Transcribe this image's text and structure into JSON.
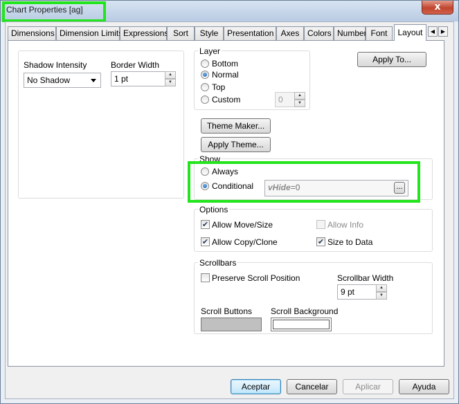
{
  "window": {
    "title": "Chart Properties [ag]",
    "close_glyph": "x"
  },
  "tabs": [
    {
      "label": "Dimensions"
    },
    {
      "label": "Dimension Limits"
    },
    {
      "label": "Expressions"
    },
    {
      "label": "Sort"
    },
    {
      "label": "Style"
    },
    {
      "label": "Presentation"
    },
    {
      "label": "Axes"
    },
    {
      "label": "Colors"
    },
    {
      "label": "Number"
    },
    {
      "label": "Font"
    },
    {
      "label": "Layout",
      "active": true
    }
  ],
  "left": {
    "shadow_label": "Shadow Intensity",
    "shadow_value": "No Shadow",
    "border_label": "Border Width",
    "border_value": "1 pt"
  },
  "layer": {
    "title": "Layer",
    "options": [
      "Bottom",
      "Normal",
      "Top",
      "Custom"
    ],
    "selected": "Normal",
    "custom_value": "0"
  },
  "buttons": {
    "apply_to": "Apply To...",
    "theme_maker": "Theme Maker...",
    "apply_theme": "Apply Theme...",
    "ellipsis": "..."
  },
  "show": {
    "title": "Show",
    "always": "Always",
    "conditional": "Conditional",
    "selected": "Conditional",
    "expression_var": "vHide",
    "expression_rest": "=0"
  },
  "options": {
    "title": "Options",
    "allow_move": {
      "label": "Allow Move/Size",
      "checked": true
    },
    "allow_copy": {
      "label": "Allow Copy/Clone",
      "checked": true
    },
    "allow_info": {
      "label": "Allow Info",
      "checked": false,
      "disabled": true
    },
    "size_to_data": {
      "label": "Size to Data",
      "checked": true
    }
  },
  "scrollbars": {
    "title": "Scrollbars",
    "preserve": {
      "label": "Preserve Scroll Position",
      "checked": false
    },
    "width_label": "Scrollbar Width",
    "width_value": "9 pt",
    "buttons_label": "Scroll Buttons",
    "background_label": "Scroll Background",
    "buttons_color": "#c0c0c0",
    "background_color": "#ffffff"
  },
  "footer": {
    "accept": "Aceptar",
    "cancel": "Cancelar",
    "apply": "Aplicar",
    "help": "Ayuda"
  },
  "highlight_color": "#22e51c"
}
